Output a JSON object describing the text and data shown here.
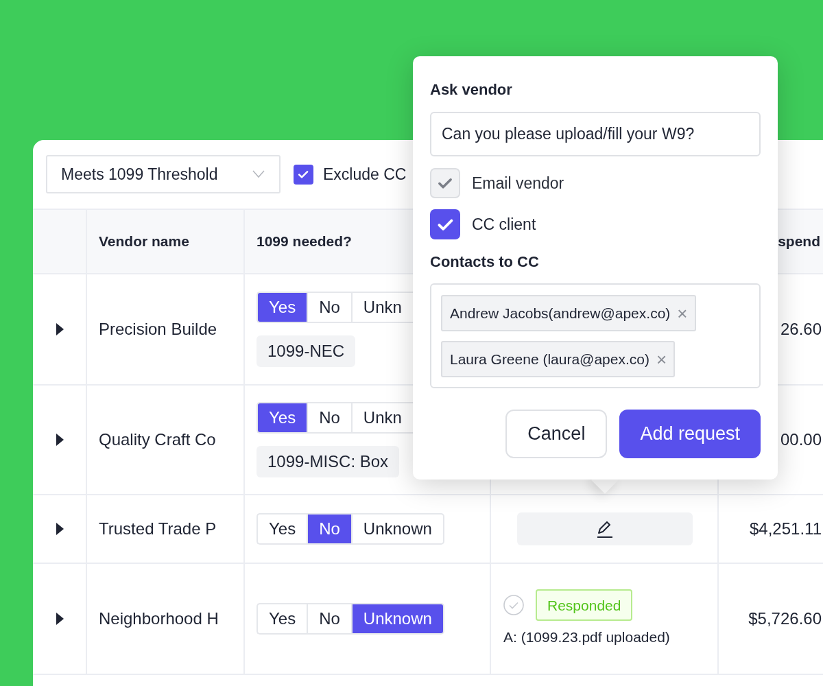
{
  "filter": {
    "dropdown": "Meets 1099 Threshold",
    "exclude": {
      "label": "Exclude CC",
      "checked": true
    }
  },
  "table": {
    "header": {
      "vendor": "Vendor name",
      "needed": "1099 needed?",
      "spend": "spend"
    },
    "rows": [
      {
        "expanded": false,
        "vendor": "Precision Builde",
        "options": [
          {
            "label": "Yes",
            "selected": true
          },
          {
            "label": "No",
            "selected": false
          },
          {
            "label": "Unkn",
            "selected": false
          }
        ],
        "form": "1099-NEC",
        "spend": "26.60"
      },
      {
        "expanded": false,
        "vendor": "Quality Craft Co",
        "options": [
          {
            "label": "Yes",
            "selected": true
          },
          {
            "label": "No",
            "selected": false
          },
          {
            "label": "Unkn",
            "selected": false
          }
        ],
        "form": "1099-MISC: Box",
        "spend": "00.00"
      },
      {
        "expanded": false,
        "vendor": "Trusted Trade P",
        "options": [
          {
            "label": "Yes",
            "selected": false
          },
          {
            "label": "No",
            "selected": true
          },
          {
            "label": "Unknown",
            "selected": false
          }
        ],
        "request": {
          "kind": "edit"
        },
        "spend": "$4,251.11"
      },
      {
        "expanded": false,
        "vendor": "Neighborhood H",
        "options": [
          {
            "label": "Yes",
            "selected": false
          },
          {
            "label": "No",
            "selected": false
          },
          {
            "label": "Unknown",
            "selected": true
          }
        ],
        "request": {
          "kind": "responded",
          "status": "Responded",
          "answer": "A: (1099.23.pdf uploaded)"
        },
        "spend": "$5,726.60"
      }
    ]
  },
  "popover": {
    "title": "Ask vendor",
    "message": "Can you please upload/fill your W9?",
    "options": [
      {
        "label": "Email vendor",
        "checked": true,
        "disabled": true
      },
      {
        "label": "CC client",
        "checked": true,
        "disabled": false
      }
    ],
    "contacts_label": "Contacts to CC",
    "contacts": [
      {
        "label": "Andrew Jacobs(andrew@apex.co)",
        "remove": "×"
      },
      {
        "label": "Laura Greene (laura@apex.co)",
        "remove": "×"
      }
    ],
    "buttons": [
      {
        "label": "Cancel",
        "kind": "secondary"
      },
      {
        "label": "Add request",
        "kind": "primary"
      }
    ]
  }
}
